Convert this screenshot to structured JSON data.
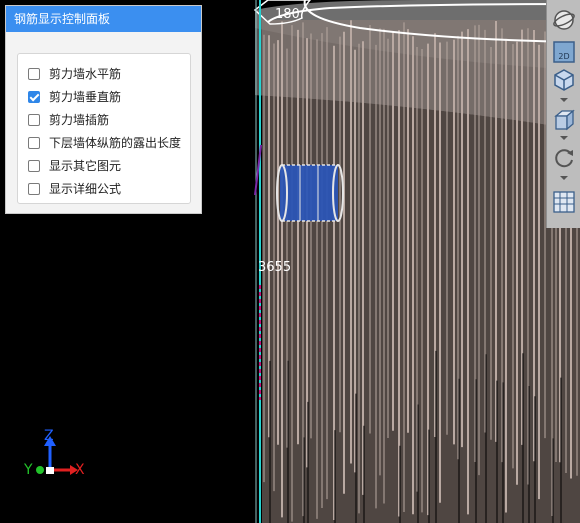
{
  "panel": {
    "title": "钢筋显示控制面板",
    "options": [
      {
        "label": "剪力墙水平筋",
        "checked": false
      },
      {
        "label": "剪力墙垂直筋",
        "checked": true
      },
      {
        "label": "剪力墙插筋",
        "checked": false
      },
      {
        "label": "下层墙体纵筋的露出长度",
        "checked": false
      },
      {
        "label": "显示其它图元",
        "checked": false
      },
      {
        "label": "显示详细公式",
        "checked": false
      }
    ]
  },
  "scene": {
    "dimension_top": "180",
    "dimension_mid": "3655"
  },
  "toolbar": {
    "icons": [
      "globe-icon",
      "2d-view-icon",
      "view-cube-icon",
      "box-view-icon",
      "rotate-icon",
      "grid-layout-icon"
    ],
    "label_2d": "2D"
  },
  "axes": {
    "x": "X",
    "y": "Y",
    "z": "Z"
  },
  "colors": {
    "panel_title": "#3b8ff0",
    "checkbox_checked": "#2f86e8",
    "rebar_vertical": "#b9a9a2",
    "rebar_ring": "#2b55b5",
    "wall_edge": "#27d3d1",
    "axis_x": "#e12020",
    "axis_y": "#22c22a",
    "axis_z": "#2060ff"
  }
}
